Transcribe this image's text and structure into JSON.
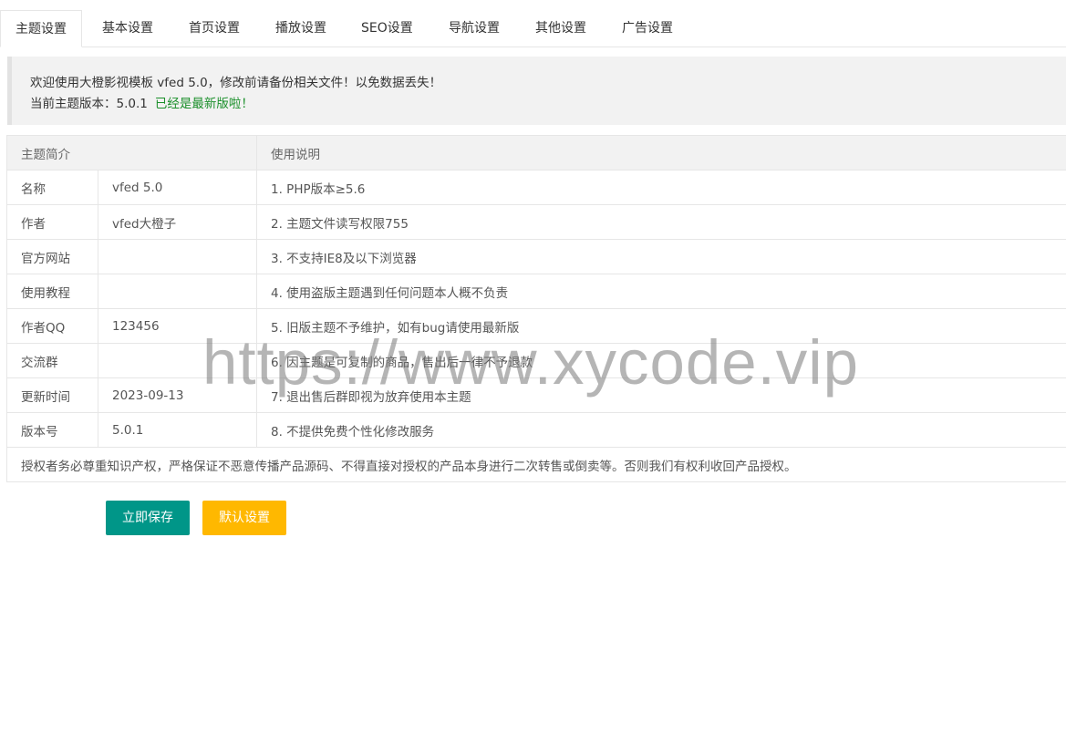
{
  "tabs": [
    {
      "label": "主题设置",
      "active": true
    },
    {
      "label": "基本设置"
    },
    {
      "label": "首页设置"
    },
    {
      "label": "播放设置"
    },
    {
      "label": "SEO设置"
    },
    {
      "label": "导航设置"
    },
    {
      "label": "其他设置"
    },
    {
      "label": "广告设置"
    }
  ],
  "notice": {
    "line1": "欢迎使用大橙影视模板 vfed 5.0，修改前请备份相关文件！以免数据丢失！",
    "version_prefix": "当前主题版本：5.0.1",
    "version_status": "已经是最新版啦！"
  },
  "table": {
    "header_intro": "主题简介",
    "header_usage": "使用说明",
    "rows": [
      {
        "label": "名称",
        "value": "vfed 5.0",
        "note": "1. PHP版本≥5.6"
      },
      {
        "label": "作者",
        "value": "vfed大橙子",
        "note": "2. 主题文件读写权限755"
      },
      {
        "label": "官方网站",
        "value": "",
        "note": "3. 不支持IE8及以下浏览器"
      },
      {
        "label": "使用教程",
        "value": "",
        "note": "4. 使用盗版主题遇到任何问题本人概不负责"
      },
      {
        "label": "作者QQ",
        "value": "123456",
        "note": "5. 旧版主题不予维护，如有bug请使用最新版"
      },
      {
        "label": "交流群",
        "value": "",
        "note": "6. 因主题是可复制的商品，售出后一律不予退款"
      },
      {
        "label": "更新时间",
        "value": "2023-09-13",
        "note": "7. 退出售后群即视为放弃使用本主题"
      },
      {
        "label": "版本号",
        "value": "5.0.1",
        "note": "8. 不提供免费个性化修改服务"
      }
    ],
    "footer": "授权者务必尊重知识产权，严格保证不恶意传播产品源码、不得直接对授权的产品本身进行二次转售或倒卖等。否则我们有权利收回产品授权。"
  },
  "buttons": {
    "save": "立即保存",
    "default": "默认设置"
  },
  "watermark": "https://www.xycode.vip",
  "colors": {
    "save": "#009688",
    "default": "#ffb800",
    "latest": "#1a8f2a"
  }
}
